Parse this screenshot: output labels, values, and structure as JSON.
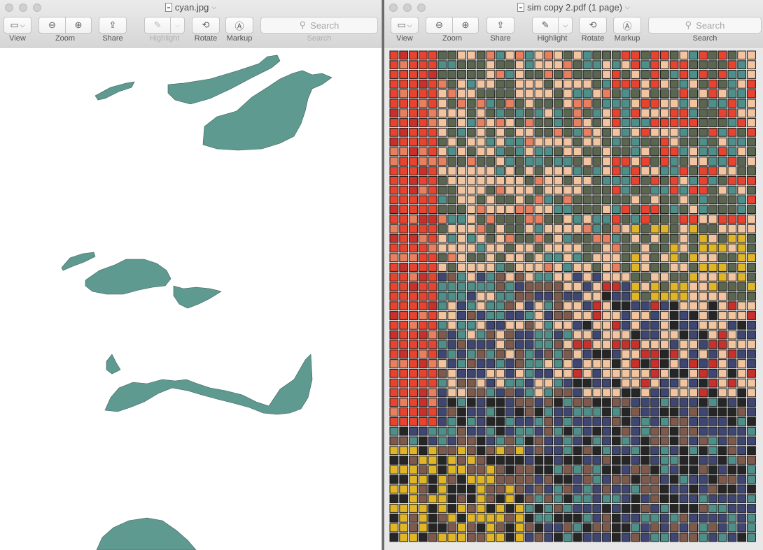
{
  "left_window": {
    "title": "cyan.jpg",
    "toolbar": {
      "view_label": "View",
      "zoom_label": "Zoom",
      "share_label": "Share",
      "highlight_label": "Highlight",
      "rotate_label": "Rotate",
      "markup_label": "Markup",
      "search_label": "Search",
      "search_placeholder": "Search"
    },
    "image_color": "#5f9a91"
  },
  "right_window": {
    "title": "sim copy 2.pdf (1 page)",
    "toolbar": {
      "view_label": "View",
      "zoom_label": "Zoom",
      "share_label": "Share",
      "highlight_label": "Highlight",
      "rotate_label": "Rotate",
      "markup_label": "Markup",
      "search_label": "Search",
      "search_placeholder": "Search"
    }
  },
  "mosaic_palette": {
    "red": "#e8432f",
    "salmon": "#e8805f",
    "peach": "#f2c5a0",
    "olive": "#5b6650",
    "teal": "#4f8f8a",
    "navy": "#3f4672",
    "gold": "#e0b526",
    "dark": "#262626",
    "brown": "#7d5a4c",
    "crimson": "#c8302c"
  }
}
